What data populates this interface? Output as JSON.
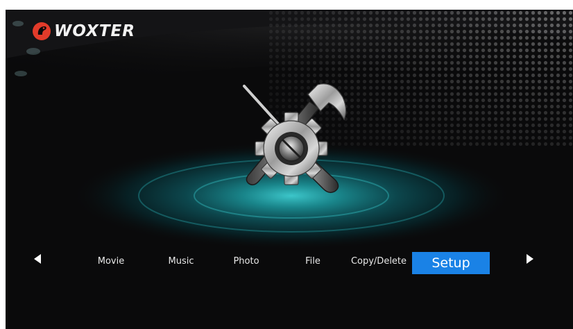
{
  "brand": {
    "name": "WOXTER",
    "logo_color": "#e23b2a"
  },
  "screen": {
    "title_icon": "setup-tools-icon"
  },
  "menu": {
    "items": [
      {
        "label": "Movie",
        "active": false
      },
      {
        "label": "Music",
        "active": false
      },
      {
        "label": "Photo",
        "active": false
      },
      {
        "label": "File",
        "active": false
      },
      {
        "label": "Copy/Delete",
        "active": false
      },
      {
        "label": "Setup",
        "active": true
      }
    ],
    "prev_icon": "triangle-left-icon",
    "next_icon": "triangle-right-icon"
  },
  "colors": {
    "background": "#0a0a0b",
    "accent": "#1a82e6",
    "glow": "#1f8f95",
    "text": "#e8e8e8"
  }
}
